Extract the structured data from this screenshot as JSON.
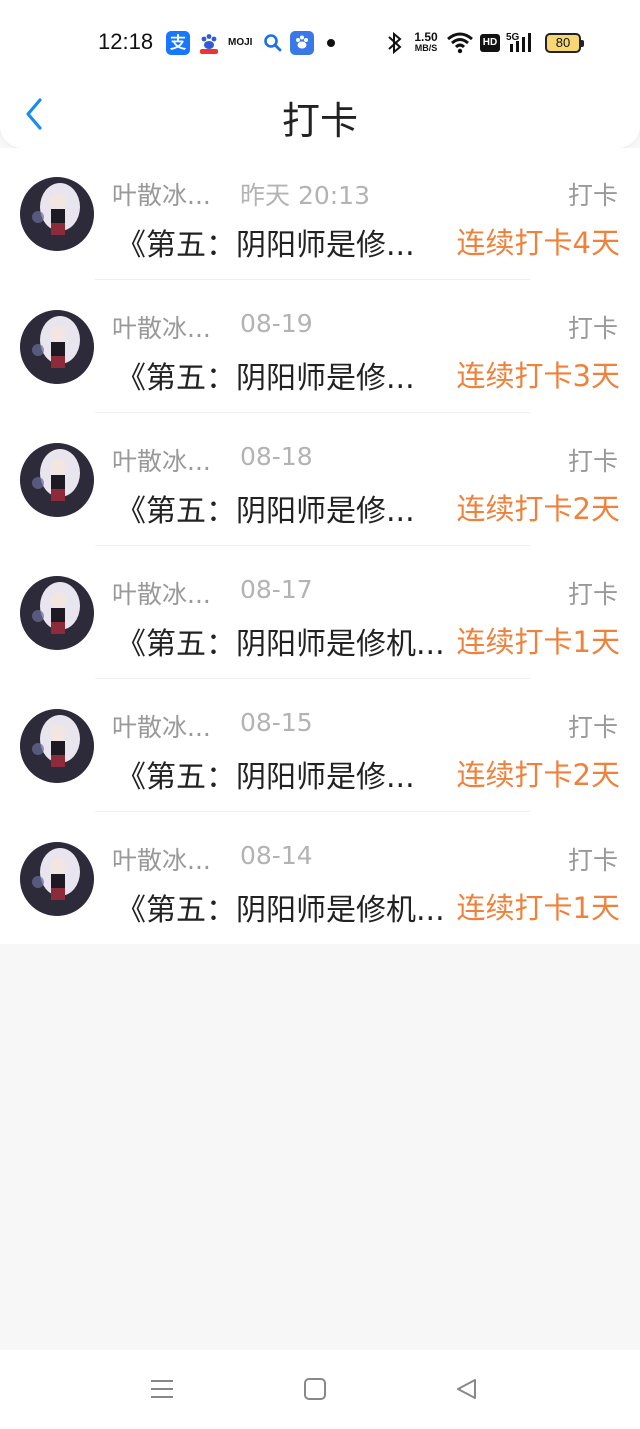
{
  "status_bar": {
    "time": "12:18",
    "alipay_glyph": "支",
    "moji": "MOJI",
    "net_speed_value": "1.50",
    "net_speed_unit": "MB/S",
    "hd": "HD",
    "network": "5G",
    "battery": "80"
  },
  "header": {
    "title": "打卡"
  },
  "rows": [
    {
      "author": "叶散冰...",
      "time": "昨天 20:13",
      "action": "打卡",
      "content": "《第五：阴阳师是修...",
      "streak": "连续打卡4天"
    },
    {
      "author": "叶散冰...",
      "time": "08-19",
      "action": "打卡",
      "content": "《第五：阴阳师是修...",
      "streak": "连续打卡3天"
    },
    {
      "author": "叶散冰...",
      "time": "08-18",
      "action": "打卡",
      "content": "《第五：阴阳师是修...",
      "streak": "连续打卡2天"
    },
    {
      "author": "叶散冰...",
      "time": "08-17",
      "action": "打卡",
      "content": "《第五：阴阳师是修机...",
      "streak": "连续打卡1天"
    },
    {
      "author": "叶散冰...",
      "time": "08-15",
      "action": "打卡",
      "content": "《第五：阴阳师是修...",
      "streak": "连续打卡2天"
    },
    {
      "author": "叶散冰...",
      "time": "08-14",
      "action": "打卡",
      "content": "《第五：阴阳师是修机...",
      "streak": "连续打卡1天"
    }
  ],
  "colors": {
    "accent": "#1a8cf0",
    "streak": "#f0813a",
    "muted": "#999999"
  },
  "icons": {
    "back": "chevron-left-icon",
    "nav_menu": "menu-icon",
    "nav_home": "home-square-icon",
    "nav_back": "triangle-back-icon"
  }
}
